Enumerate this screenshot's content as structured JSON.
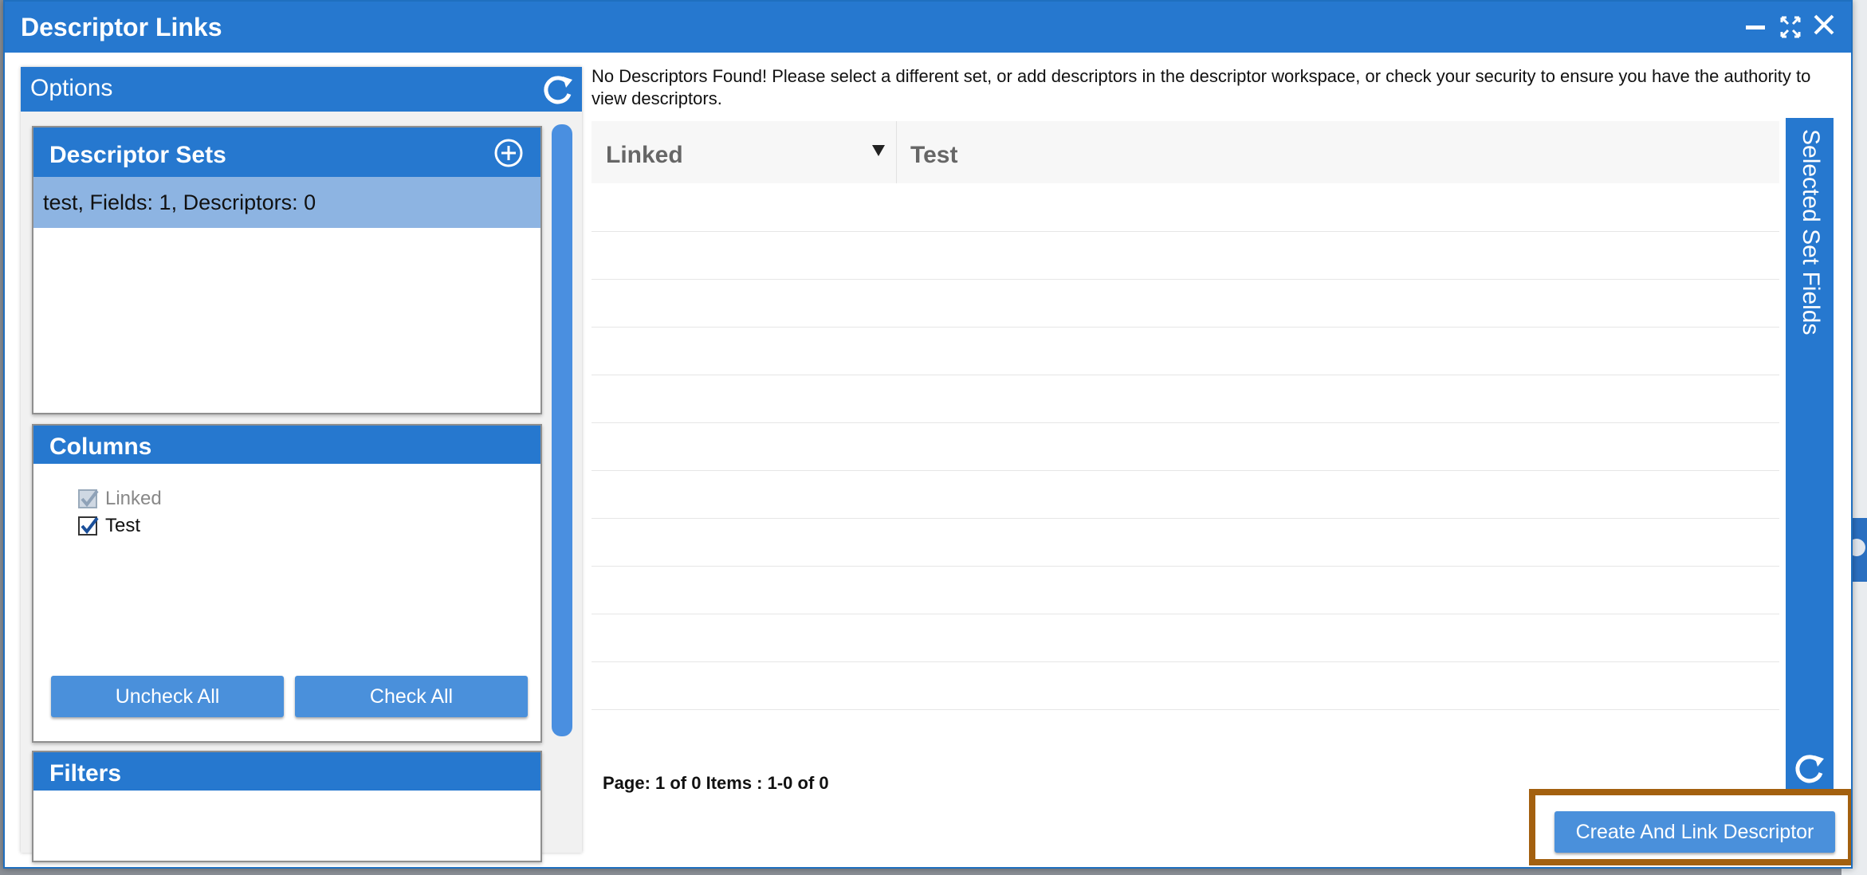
{
  "dialog": {
    "title": "Descriptor Links"
  },
  "options": {
    "header": "Options",
    "descriptor_sets": {
      "title": "Descriptor Sets",
      "items": [
        "test, Fields: 1, Descriptors: 0"
      ]
    },
    "columns": {
      "title": "Columns",
      "items": [
        {
          "label": "Linked",
          "checked": true,
          "disabled": true
        },
        {
          "label": "Test",
          "checked": true,
          "disabled": false
        }
      ],
      "uncheck_all": "Uncheck All",
      "check_all": "Check All"
    },
    "filters": {
      "title": "Filters"
    }
  },
  "main": {
    "notice": "No Descriptors Found! Please select a different set, or add descriptors in the descriptor workspace, or check your security to ensure you have the authority to view descriptors.",
    "grid": {
      "columns": [
        "Linked",
        "Test"
      ]
    },
    "pager": "Page: 1 of 0 Items : 1-0 of 0",
    "side_tab": "Selected Set Fields",
    "create_button": "Create And Link Descriptor"
  },
  "colors": {
    "primary": "#2678cf",
    "selected_row": "#8db4e2",
    "button": "#4a90db",
    "highlight": "#a3600f"
  }
}
